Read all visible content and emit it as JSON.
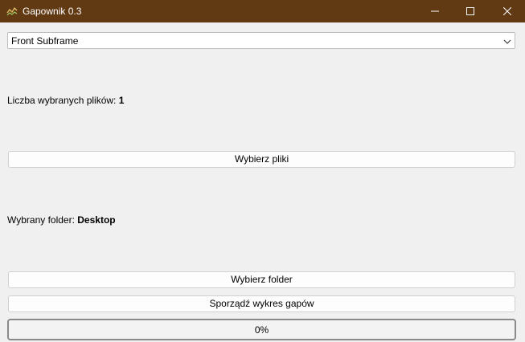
{
  "window": {
    "title": "Gapownik 0.3",
    "titlebar_color": "#613912",
    "icons": [
      "app-chart-icon",
      "minimize-icon",
      "maximize-icon",
      "close-icon"
    ]
  },
  "mode_select": {
    "value": "Front Subframe",
    "icon": "chevron-down-icon"
  },
  "files": {
    "label": "Liczba wybranych plików: ",
    "count": "1",
    "button_label": "Wybierz pliki"
  },
  "folder": {
    "label": "Wybrany folder: ",
    "name": "Desktop",
    "button_label": "Wybierz folder"
  },
  "plot_button_label": "Sporządź wykres gapów",
  "progress": {
    "value": 0,
    "text": "0%",
    "fill_color": "#06b025"
  }
}
